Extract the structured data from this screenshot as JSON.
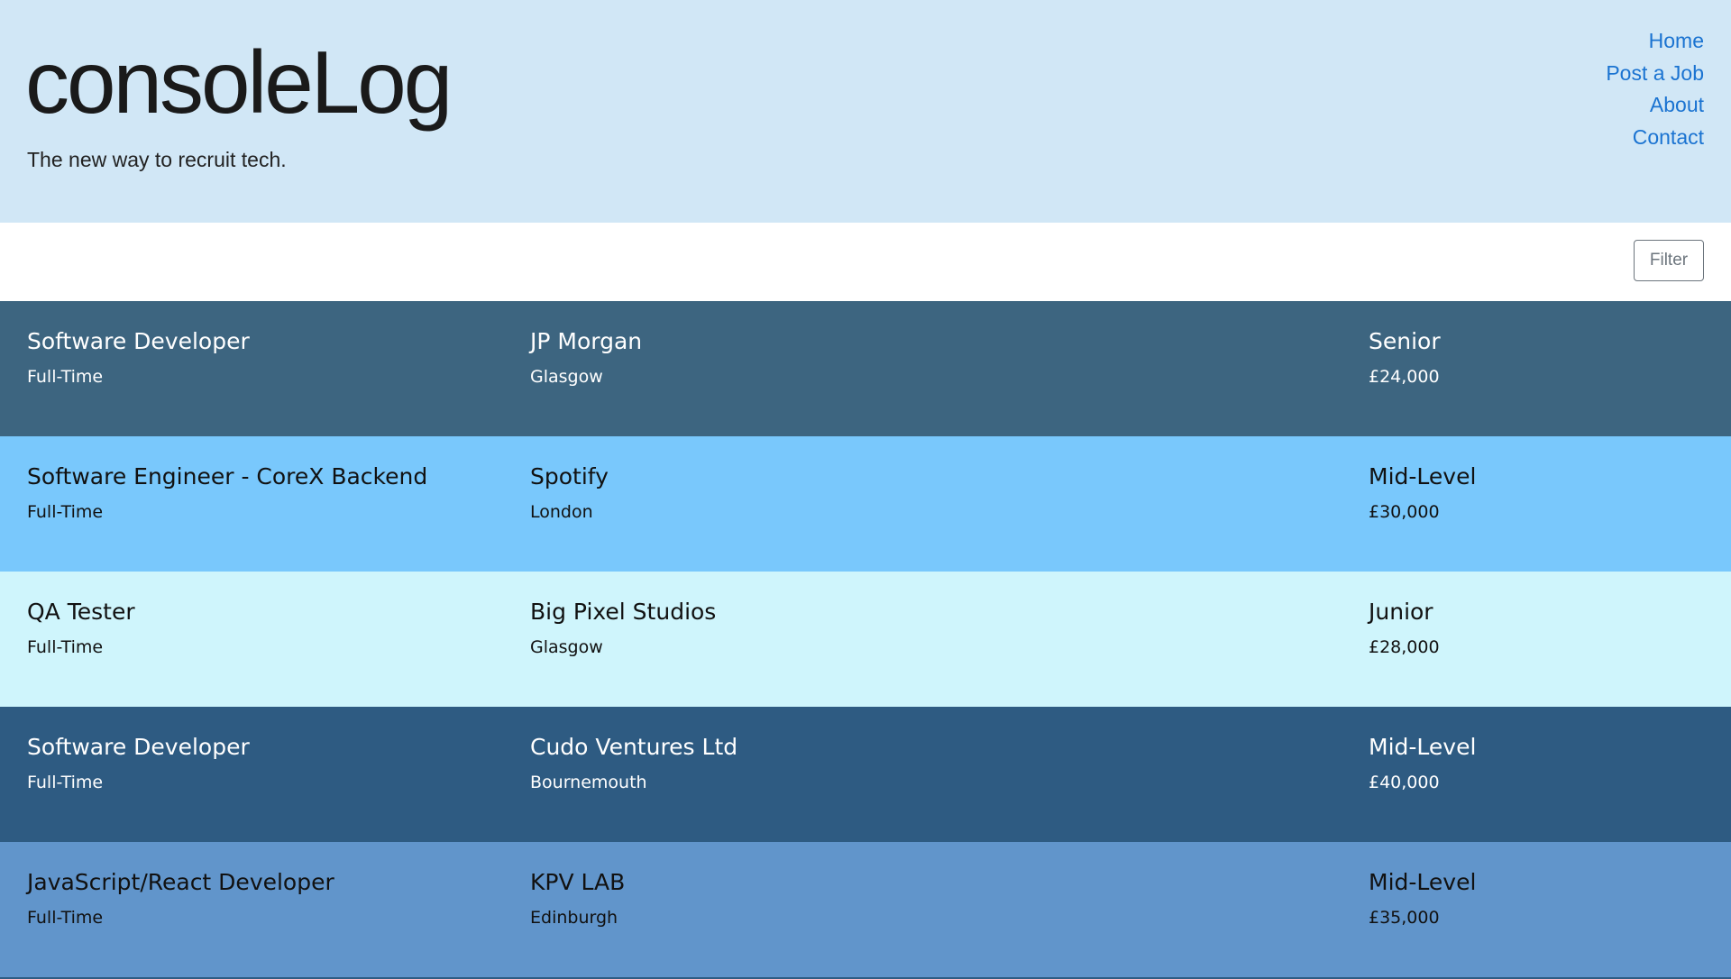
{
  "header": {
    "title": "consoleLog",
    "tagline": "The new way to recruit tech.",
    "background": "#d1e7f6",
    "nav": [
      {
        "label": "Home"
      },
      {
        "label": "Post a Job"
      },
      {
        "label": "About"
      },
      {
        "label": "Contact"
      }
    ],
    "nav_color": "#1a73d1"
  },
  "toolbar": {
    "filter_label": "Filter"
  },
  "jobs": [
    {
      "title": "Software Developer",
      "type": "Full-Time",
      "company": "JP Morgan",
      "location": "Glasgow",
      "level": "Senior",
      "salary": "£24,000",
      "bg": "#3d6580",
      "fg": "#ffffff"
    },
    {
      "title": "Software Engineer - CoreX Backend",
      "type": "Full-Time",
      "company": "Spotify",
      "location": "London",
      "level": "Mid-Level",
      "salary": "£30,000",
      "bg": "#79c8fc",
      "fg": "#111111"
    },
    {
      "title": "QA Tester",
      "type": "Full-Time",
      "company": "Big Pixel Studios",
      "location": "Glasgow",
      "level": "Junior",
      "salary": "£28,000",
      "bg": "#cff5fc",
      "fg": "#111111"
    },
    {
      "title": "Software Developer",
      "type": "Full-Time",
      "company": "Cudo Ventures Ltd",
      "location": "Bournemouth",
      "level": "Mid-Level",
      "salary": "£40,000",
      "bg": "#2e5b82",
      "fg": "#ffffff"
    },
    {
      "title": "JavaScript/React Developer",
      "type": "Full-Time",
      "company": "KPV LAB",
      "location": "Edinburgh",
      "level": "Mid-Level",
      "salary": "£35,000",
      "bg": "#6195cb",
      "fg": "#111111"
    }
  ]
}
